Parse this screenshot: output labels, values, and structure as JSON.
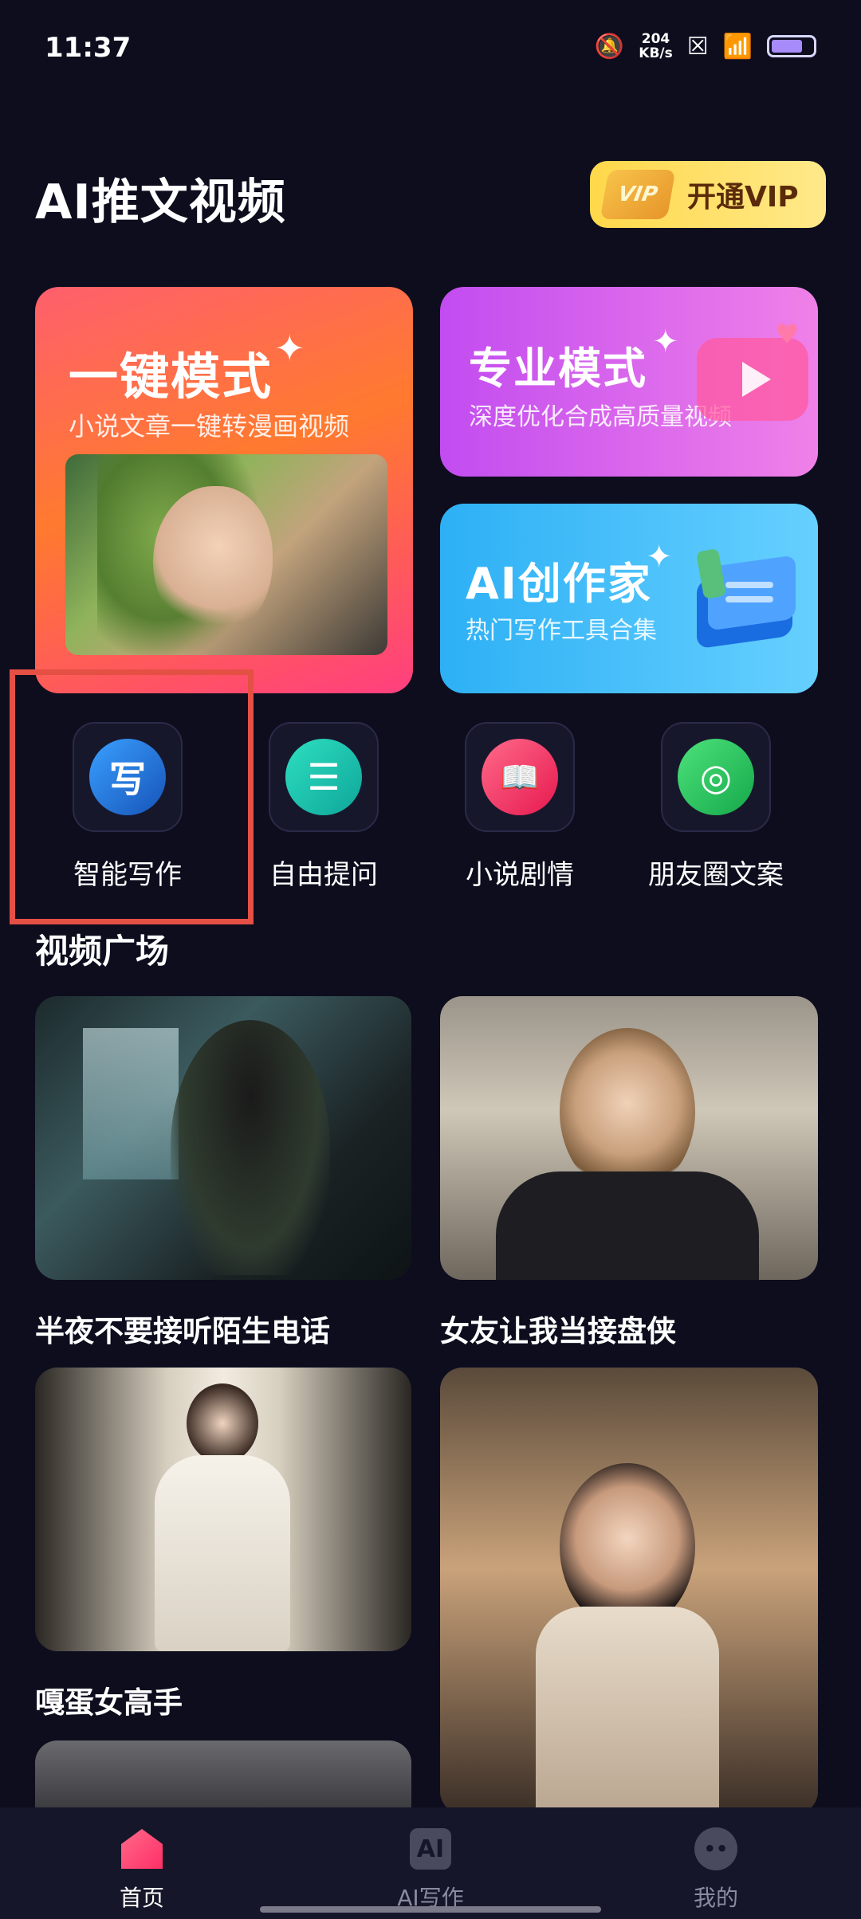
{
  "status_bar": {
    "time": "11:37",
    "net_speed_value": "204",
    "net_speed_unit": "KB/s"
  },
  "header": {
    "title": "AI推文视频",
    "vip_badge": "VIP",
    "vip_button_label": "开通VIP"
  },
  "feature_cards": {
    "one_key": {
      "title": "一键模式",
      "subtitle": "小说文章一键转漫画视频"
    },
    "pro": {
      "title": "专业模式",
      "subtitle": "深度优化合成高质量视频"
    },
    "ai_writer": {
      "title": "AI创作家",
      "subtitle": "热门写作工具合集"
    }
  },
  "tools": [
    {
      "label": "智能写作",
      "glyph": "写",
      "icon": "write-icon",
      "color": "#1e6fd6"
    },
    {
      "label": "自由提问",
      "glyph": "☰",
      "icon": "chat-icon",
      "color": "#13b8a6"
    },
    {
      "label": "小说剧情",
      "glyph": "📖",
      "icon": "book-icon",
      "color": "#ff3d6e"
    },
    {
      "label": "朋友圈文案",
      "glyph": "◎",
      "icon": "aperture-icon",
      "color": "#21c55d"
    }
  ],
  "video_section": {
    "title": "视频广场",
    "videos": [
      {
        "title": "半夜不要接听陌生电话"
      },
      {
        "title": "女友让我当接盘侠"
      },
      {
        "title": "嘎蛋女高手"
      }
    ]
  },
  "bottom_nav": [
    {
      "label": "首页",
      "icon": "home-icon",
      "active": true
    },
    {
      "label": "AI写作",
      "icon": "ai-write-icon",
      "active": false
    },
    {
      "label": "我的",
      "icon": "profile-icon",
      "active": false
    }
  ],
  "colors": {
    "background": "#0d0d1e",
    "vip_gold": "#ffd84a",
    "highlight_box": "#e45043",
    "nav_active": "#ff3d6e"
  }
}
